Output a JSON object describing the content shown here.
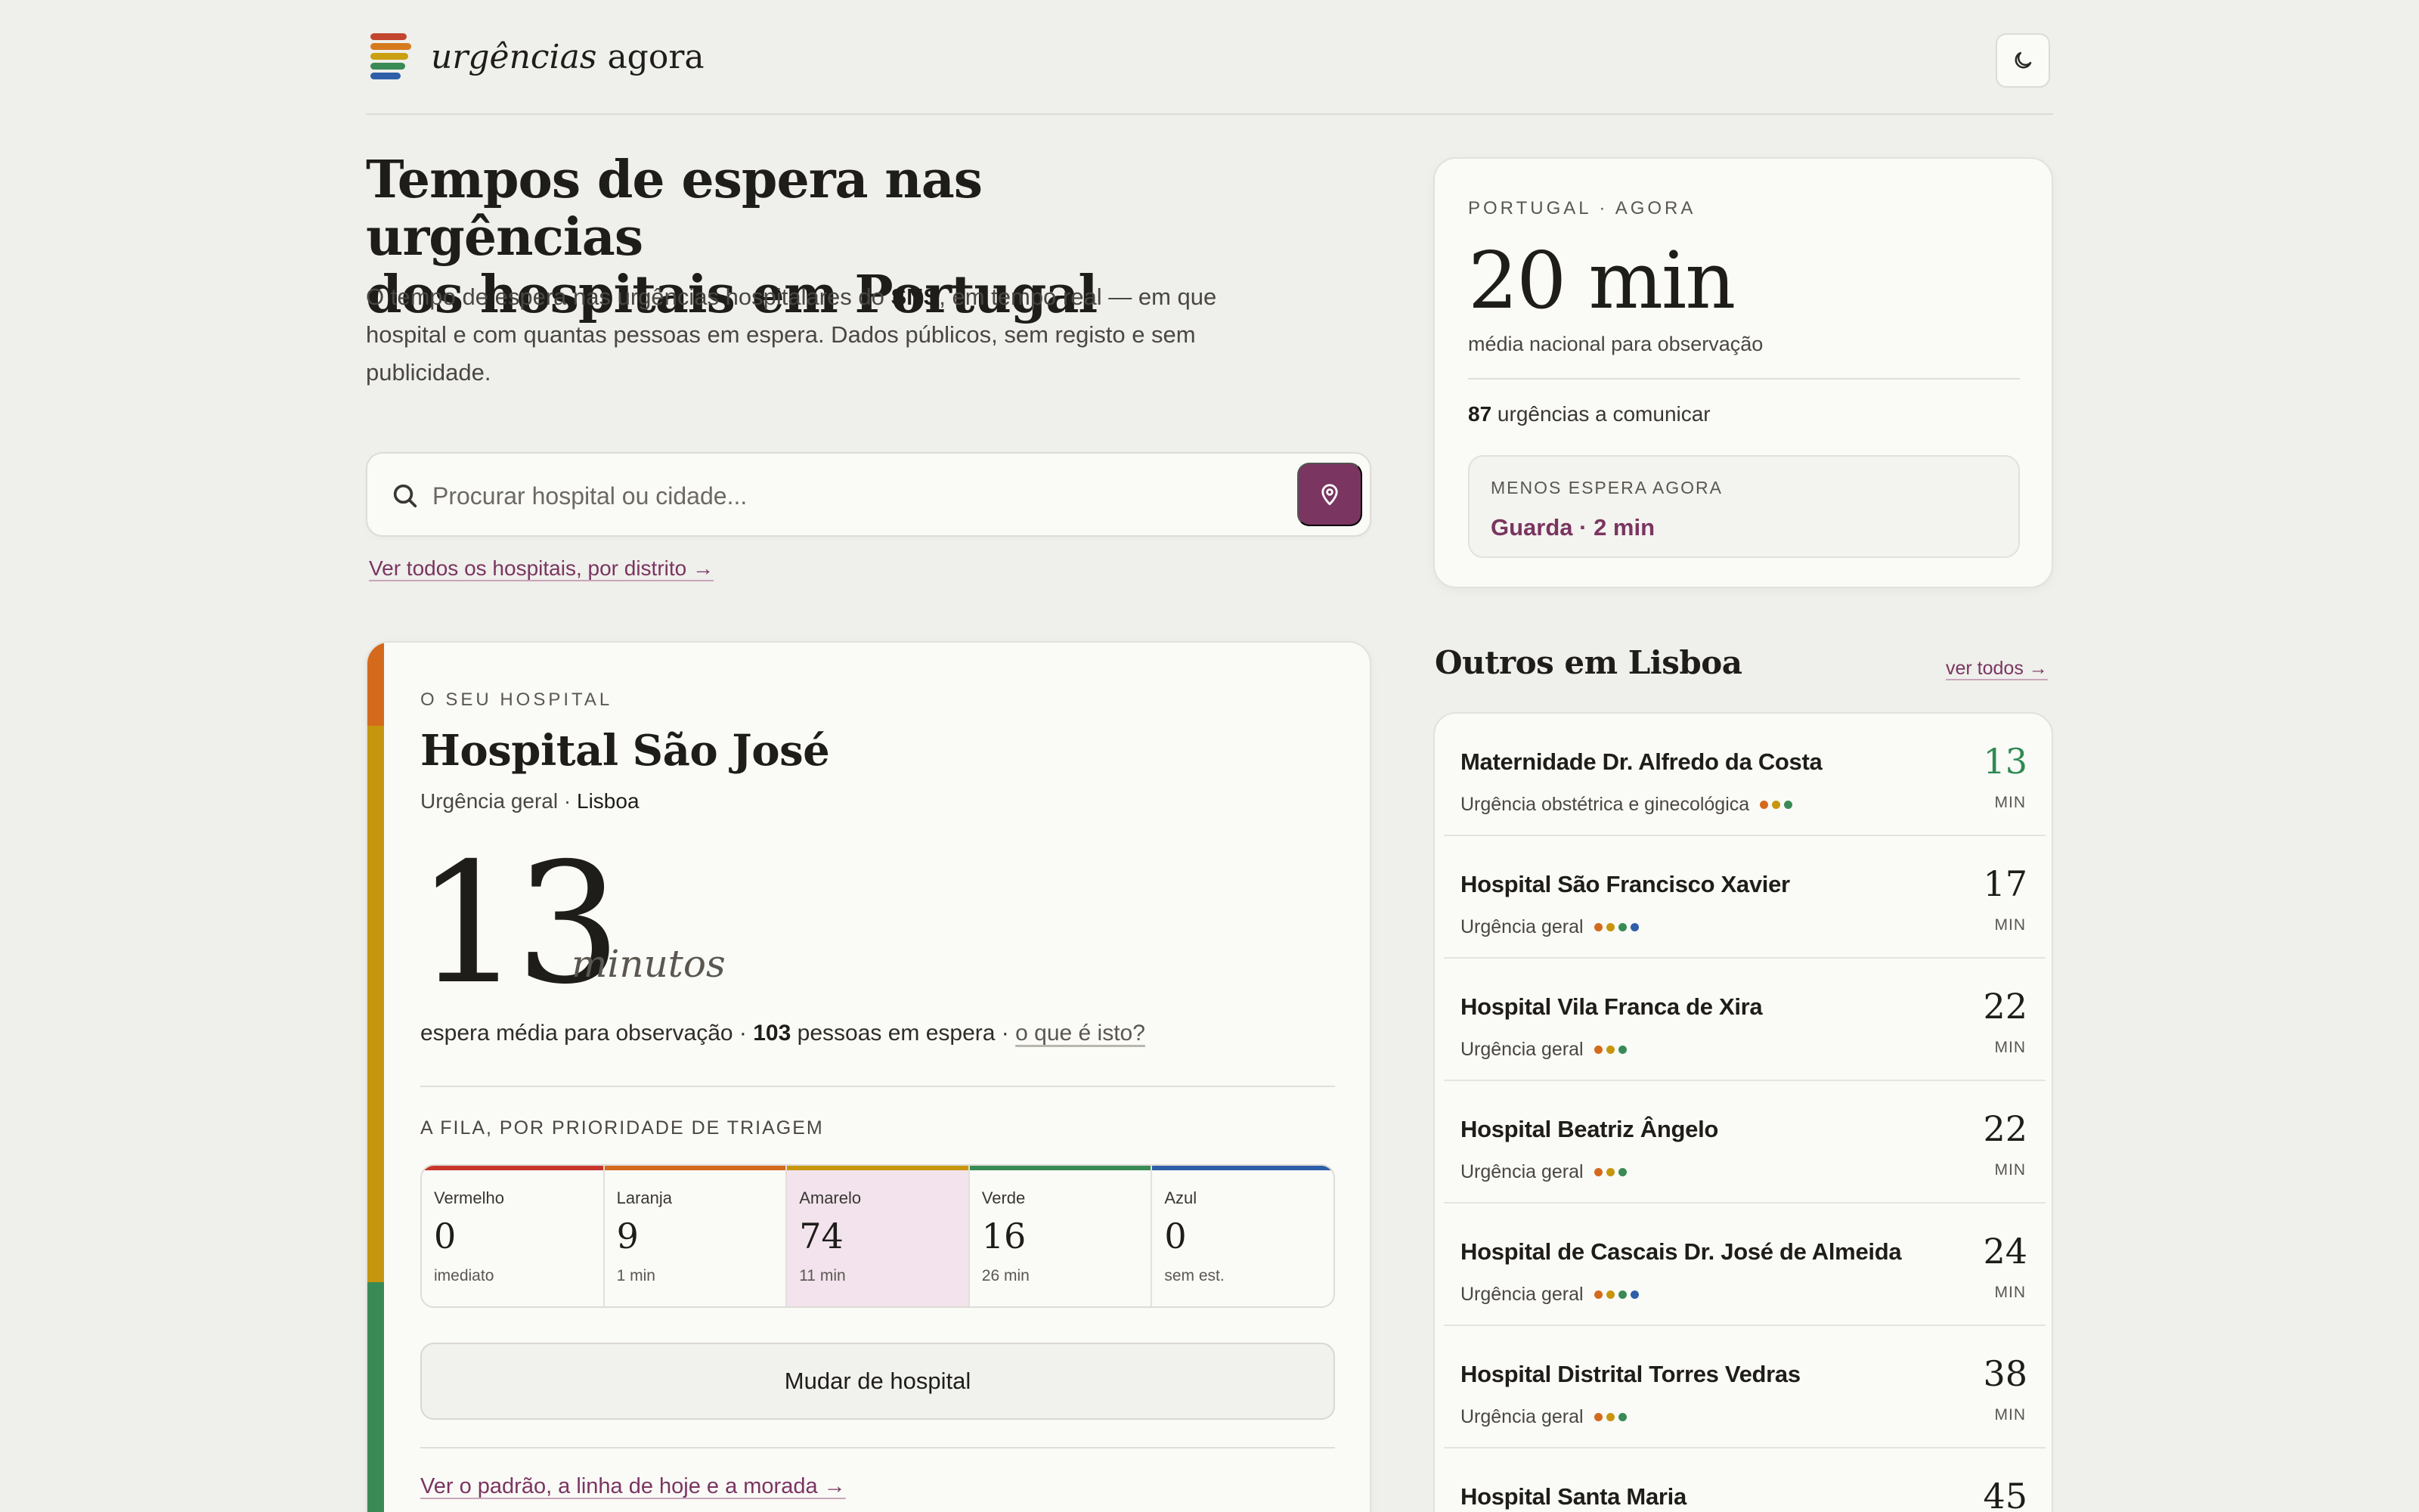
{
  "brand": {
    "italic": "urgências",
    "bold": "agora",
    "colors": [
      "#c2452d",
      "#d67a1e",
      "#caa012",
      "#3a8a55",
      "#2e5fa8"
    ]
  },
  "header": {
    "theme_toggle_icon": "moon-icon"
  },
  "hero": {
    "title_line1": "Tempos de espera nas urgências",
    "title_line2": "dos hospitais em Portugal",
    "desc_a": "O tempo de espera nas urgências hospitalares do ",
    "desc_bold": "SNS",
    "desc_b": ", em tempo real — em que hospital e com quantas pessoas em espera. Dados públicos, sem registo e sem publicidade."
  },
  "search": {
    "placeholder": "Procurar hospital ou cidade...",
    "value": "",
    "all_link": "Ver todos os hospitais, por distrito →"
  },
  "national": {
    "eyebrow": "PORTUGAL · AGORA",
    "value": "20 min",
    "sub": "média nacional para observação",
    "count": "87",
    "count_text": " urgências a comunicar",
    "least_label": "MENOS ESPERA AGORA",
    "least_value": "Guarda · 2 min"
  },
  "hospital": {
    "eyebrow": "O SEU HOSPITAL",
    "name": "Hospital São José",
    "type": "Urgência geral",
    "city": "Lisboa",
    "minutes": "13",
    "unit": "minutos",
    "info_a": "espera média para observação · ",
    "people": "103",
    "info_b": " pessoas em espera · ",
    "info_link": "o que é isto?",
    "queue_label": "A FILA, POR PRIORIDADE DE TRIAGEM",
    "triage": [
      {
        "name": "Vermelho",
        "count": "0",
        "time": "imediato",
        "color": "#c9352b"
      },
      {
        "name": "Laranja",
        "count": "9",
        "time": "1 min",
        "color": "#d46a1c"
      },
      {
        "name": "Amarelo",
        "count": "74",
        "time": "11 min",
        "color": "#c7960f"
      },
      {
        "name": "Verde",
        "count": "16",
        "time": "26 min",
        "color": "#3a8a55"
      },
      {
        "name": "Azul",
        "count": "0",
        "time": "sem est.",
        "color": "#2e5fa8"
      }
    ],
    "change_button": "Mudar de hospital",
    "pattern_link": "Ver o padrão, a linha de hoje e a morada →"
  },
  "others": {
    "title": "Outros em Lisboa",
    "all_link": "ver todos →",
    "unit": "MIN",
    "items": [
      {
        "name": "Maternidade Dr. Alfredo da Costa",
        "type": "Urgência obstétrica e ginecológica",
        "value": "13",
        "value_color": "#2f8a52",
        "dots": [
          "#d46a1c",
          "#c7960f",
          "#3a8a55"
        ]
      },
      {
        "name": "Hospital São Francisco Xavier",
        "type": "Urgência geral",
        "value": "17",
        "value_color": "#1f1d1a",
        "dots": [
          "#d46a1c",
          "#c7960f",
          "#3a8a55",
          "#2e5fa8"
        ]
      },
      {
        "name": "Hospital Vila Franca de Xira",
        "type": "Urgência geral",
        "value": "22",
        "value_color": "#1f1d1a",
        "dots": [
          "#d46a1c",
          "#c7960f",
          "#3a8a55"
        ]
      },
      {
        "name": "Hospital Beatriz Ângelo",
        "type": "Urgência geral",
        "value": "22",
        "value_color": "#1f1d1a",
        "dots": [
          "#d46a1c",
          "#c7960f",
          "#3a8a55"
        ]
      },
      {
        "name": "Hospital de Cascais Dr. José de Almeida",
        "type": "Urgência geral",
        "value": "24",
        "value_color": "#1f1d1a",
        "dots": [
          "#d46a1c",
          "#c7960f",
          "#3a8a55",
          "#2e5fa8"
        ]
      },
      {
        "name": "Hospital Distrital Torres Vedras",
        "type": "Urgência geral",
        "value": "38",
        "value_color": "#1f1d1a",
        "dots": [
          "#d46a1c",
          "#c7960f",
          "#3a8a55"
        ]
      },
      {
        "name": "Hospital Santa Maria",
        "type": "",
        "value": "45",
        "value_color": "#1f1d1a",
        "dots": []
      }
    ]
  }
}
